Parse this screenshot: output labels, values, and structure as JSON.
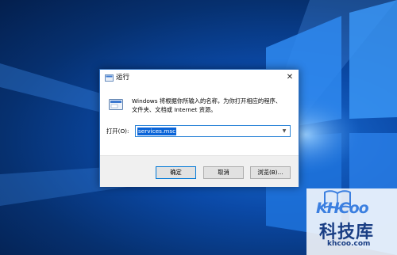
{
  "dialog": {
    "title": "运行",
    "close_label": "✕",
    "description_line1": "Windows 将根据你所输入的名称，为你打开相应的程序、",
    "description_line2": "文件夹、文档或 Internet 资源。",
    "open_label": "打开(O):",
    "open_value": "services.msc",
    "ok_label": "确定",
    "cancel_label": "取消",
    "browse_label": "浏览(B)..."
  },
  "watermark": {
    "brand": "KHCoo",
    "cn_name": "科技库",
    "domain": "khcoo.com"
  },
  "colors": {
    "desktop_blue": "#0b4aa8",
    "accent": "#0078d7",
    "selection": "#0a64d8"
  },
  "icons": [
    "run-app-icon",
    "close-icon",
    "chevron-down-icon",
    "windows-light-icon"
  ]
}
